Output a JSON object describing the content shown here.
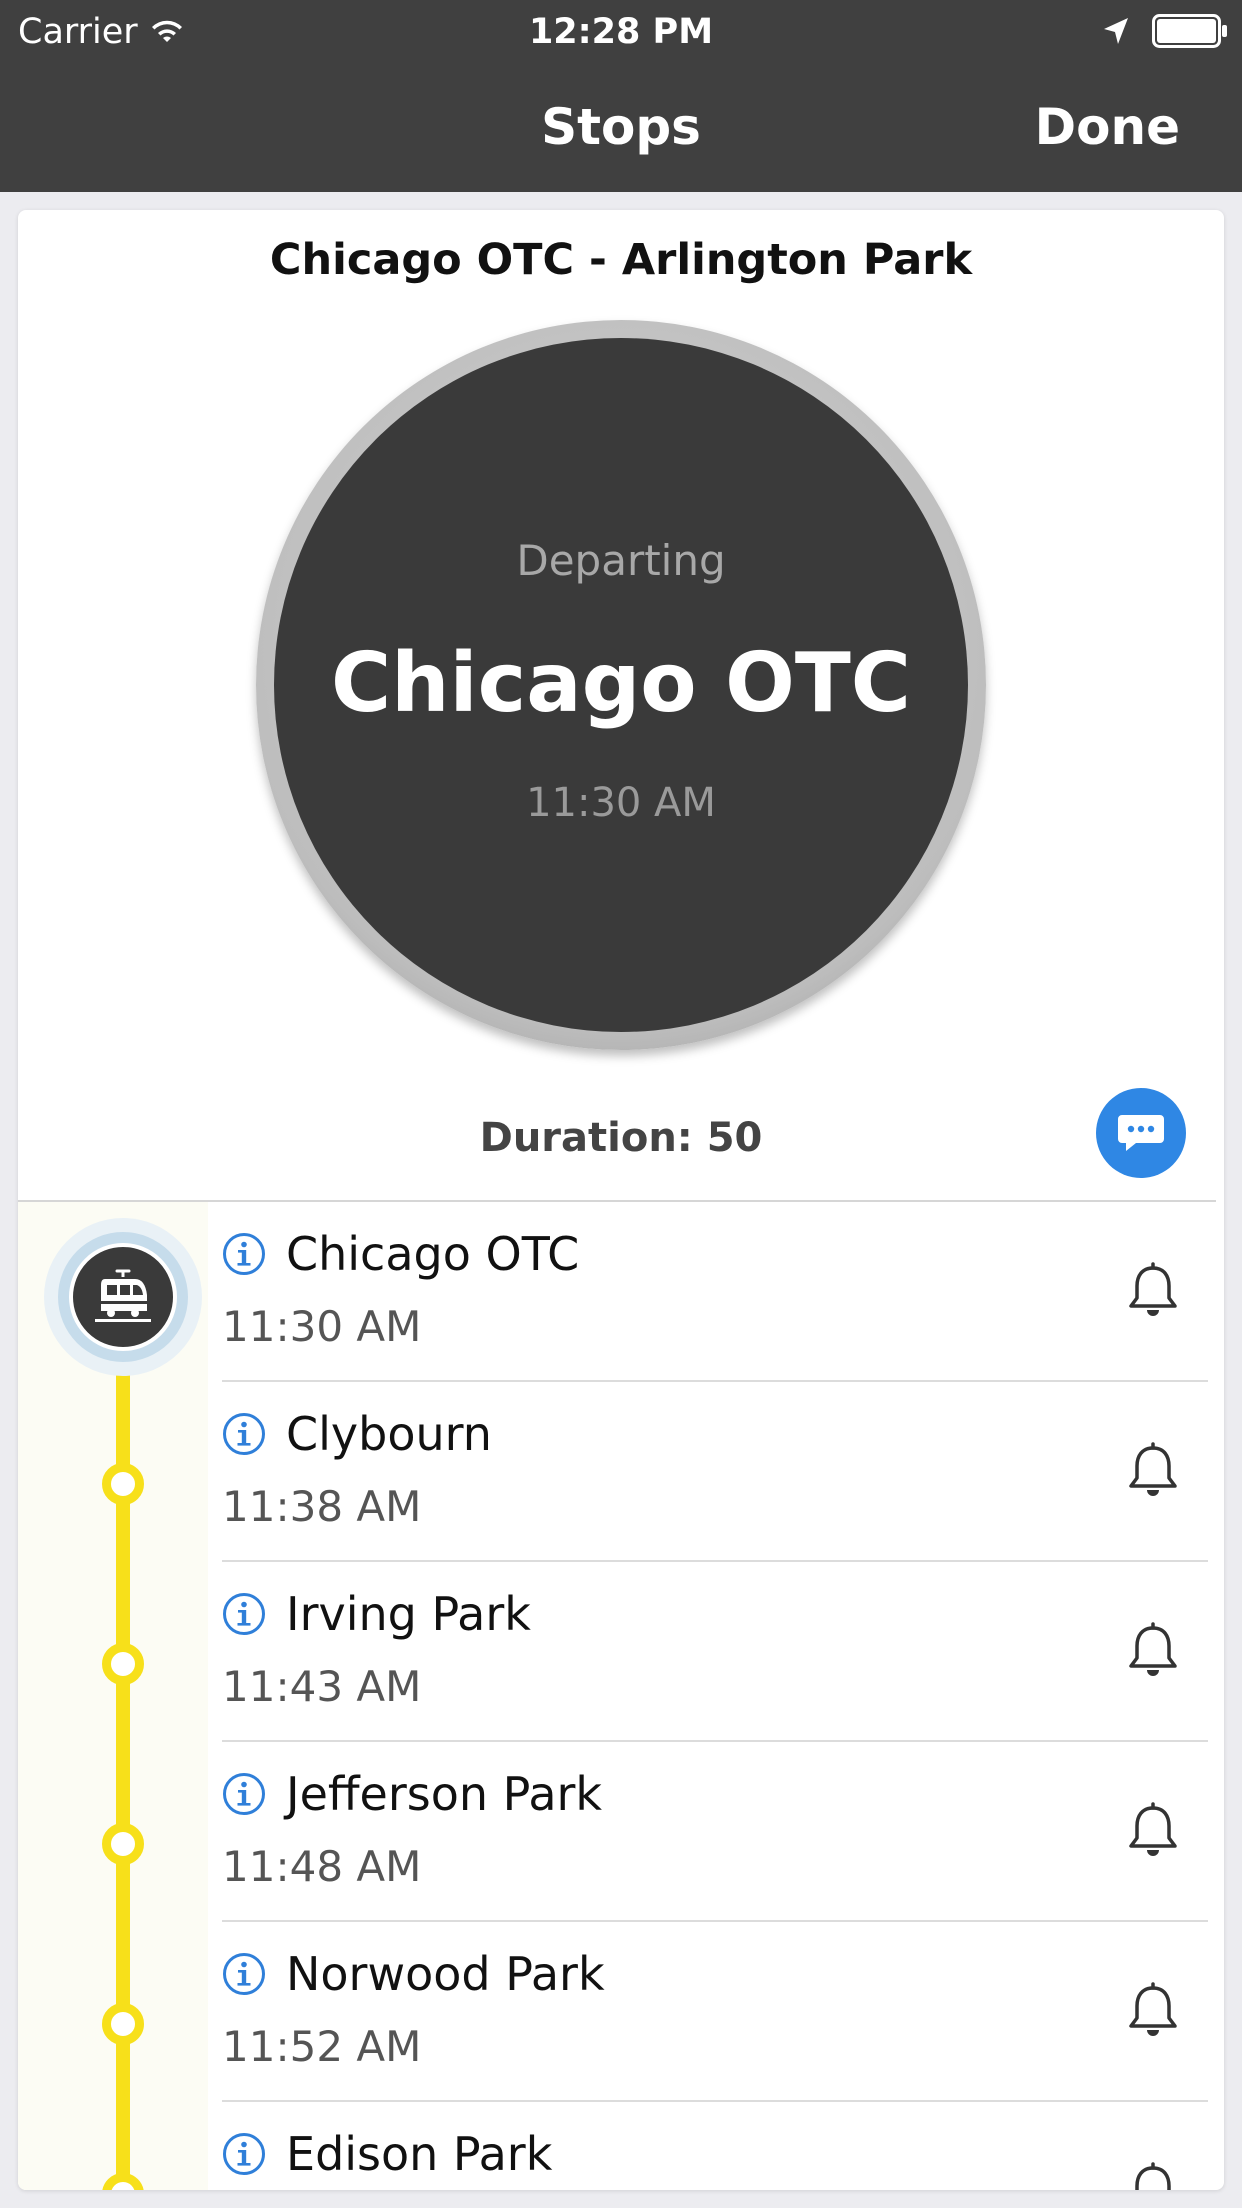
{
  "status_bar": {
    "carrier": "Carrier",
    "time": "12:28 PM"
  },
  "nav": {
    "title": "Stops",
    "done_label": "Done"
  },
  "route": {
    "title": "Chicago OTC - Arlington Park"
  },
  "departure": {
    "label": "Departing",
    "station": "Chicago OTC",
    "time": "11:30 AM"
  },
  "duration": {
    "text": "Duration: 50"
  },
  "stops": [
    {
      "name": "Chicago OTC",
      "time": "11:30 AM"
    },
    {
      "name": "Clybourn",
      "time": "11:38 AM"
    },
    {
      "name": "Irving Park",
      "time": "11:43 AM"
    },
    {
      "name": "Jefferson Park",
      "time": "11:48 AM"
    },
    {
      "name": "Norwood Park",
      "time": "11:52 AM"
    },
    {
      "name": "Edison Park",
      "time": ""
    }
  ],
  "colors": {
    "nav_background": "#404040",
    "timeline_line": "#f7e01a",
    "chat_button": "#2f87e4",
    "info_icon": "#2f7fd9"
  },
  "icons": {
    "wifi": "wifi-icon",
    "location": "location-arrow-icon",
    "battery": "battery-full-icon",
    "chat": "chat-bubble-icon",
    "train": "train-icon",
    "info": "info-icon",
    "bell": "bell-icon"
  }
}
